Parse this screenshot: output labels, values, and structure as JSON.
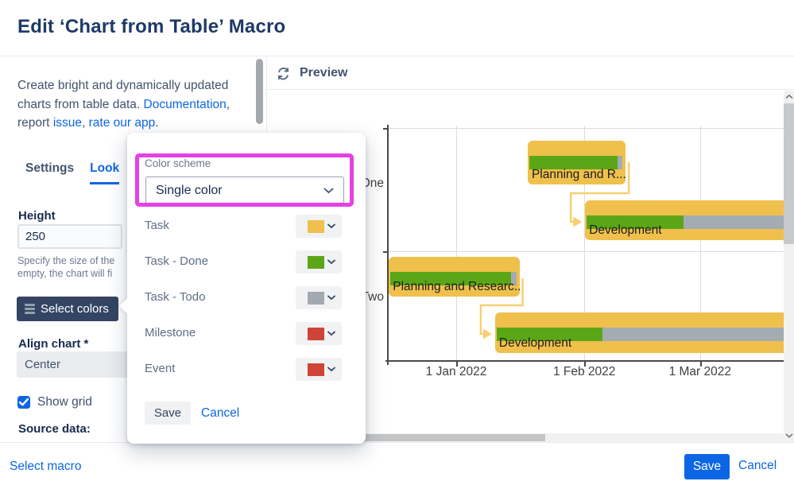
{
  "dialog": {
    "title": "Edit ‘Chart from Table’ Macro"
  },
  "sidebar": {
    "intro": {
      "text": "Create bright and dynamically updated charts from table data. ",
      "doc_link": "Documentation",
      "mid1": ", report ",
      "issue_link": "issue",
      "mid2": ", ",
      "rate_link": "rate our app",
      "end": "."
    },
    "tabs": [
      {
        "label": "Settings",
        "active": false
      },
      {
        "label": "Look",
        "active": true
      }
    ],
    "height_label": "Height",
    "height_value": "250",
    "height_help_line1": "Specify the size of the",
    "height_help_line2": "empty, the chart will fi",
    "select_colors_button": "Select colors",
    "align_label": "Align chart *",
    "align_value": "Center",
    "show_grid_label": "Show grid",
    "show_grid_checked": true,
    "source_data_label": "Source data:"
  },
  "color_popup": {
    "scheme_label": "Color scheme",
    "scheme_value": "Single color",
    "highlight_color": "#e441e4",
    "rows": [
      {
        "label": "Task",
        "color": "#efc04c"
      },
      {
        "label": "Task - Done",
        "color": "#5ba616"
      },
      {
        "label": "Task - Todo",
        "color": "#a2a9b0"
      },
      {
        "label": "Milestone",
        "color": "#d04437"
      },
      {
        "label": "Event",
        "color": "#d04437"
      }
    ],
    "save_label": "Save",
    "cancel_label": "Cancel"
  },
  "preview": {
    "header": "Preview"
  },
  "chart_data": {
    "type": "bar",
    "variant": "gantt",
    "title": "",
    "xlabel": "",
    "x_axis_ticks": [
      {
        "label": "1 Jan 2022",
        "day": 0
      },
      {
        "label": "1 Feb 2022",
        "day": 31
      },
      {
        "label": "1 Mar 2022",
        "day": 59
      }
    ],
    "rows": [
      {
        "label": "One"
      },
      {
        "label": "Two"
      }
    ],
    "tasks": [
      {
        "row": "One",
        "name": "Planning and R...",
        "start_day": 17.3,
        "end_day": 41.0,
        "progress": 0.95,
        "clipped": false
      },
      {
        "row": "One",
        "name": "Development",
        "start_day": 31.2,
        "end_day": null,
        "progress": 0.49,
        "clipped": true
      },
      {
        "row": "Two",
        "name": "Planning and Researc...",
        "start_day": -16.3,
        "end_day": 15.3,
        "progress": 0.96,
        "clipped": false
      },
      {
        "row": "Two",
        "name": "Development",
        "start_day": 9.4,
        "end_day": null,
        "progress": 0.37,
        "clipped": true
      }
    ],
    "dependencies": [
      [
        0,
        1
      ],
      [
        2,
        3
      ]
    ],
    "colors": {
      "task": "#efc04c",
      "done": "#5ba616",
      "todo": "#a5abb2",
      "connector": "#f6cf75"
    },
    "grid": true
  },
  "footer": {
    "select_macro": "Select macro",
    "save": "Save",
    "cancel": "Cancel"
  }
}
